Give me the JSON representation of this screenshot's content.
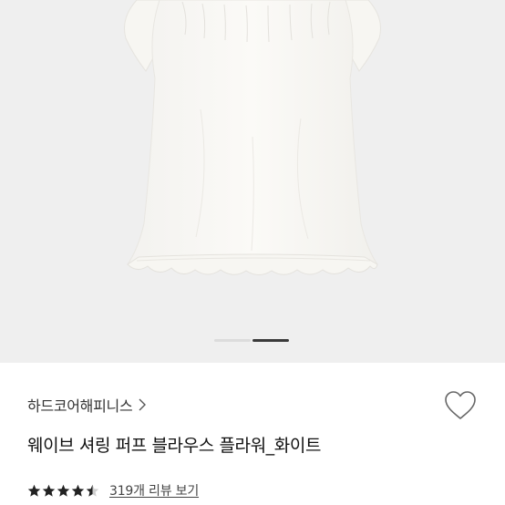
{
  "product_image": {
    "subject": "white blouse",
    "background_color": "#efefef",
    "carousel": {
      "slide_count": 2,
      "active_index": 1
    }
  },
  "brand": {
    "name": "하드코어해피니스",
    "chevron_icon": "chevron-right-icon"
  },
  "wishlist": {
    "icon": "heart-outline-icon"
  },
  "product": {
    "title": "웨이브 셔링 퍼프 블라우스 플라워_화이트"
  },
  "rating": {
    "stars": 4.5,
    "star_color": "#222222",
    "review_link": "319개 리뷰 보기"
  }
}
